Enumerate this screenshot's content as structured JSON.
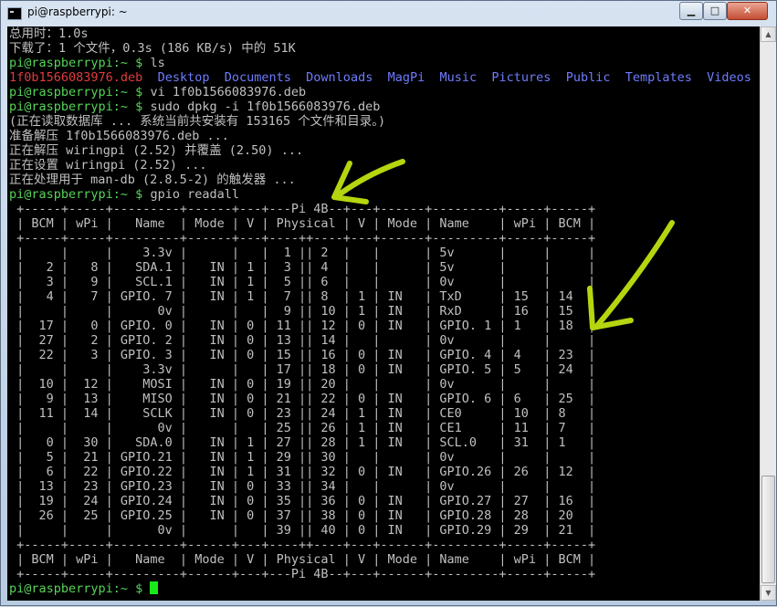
{
  "window": {
    "title": "pi@raspberrypi: ~"
  },
  "controls": {
    "minimize": "▁",
    "maximize": "□",
    "close": "✕"
  },
  "colors": {
    "prompt": "#57d457",
    "directory": "#6e7cff",
    "archive": "#e03c3c",
    "cursor": "#19e819",
    "annotation": "#b5d60f"
  },
  "icons": [
    "terminal-icon",
    "annotation-arrow-icon"
  ],
  "lines": [
    [
      {
        "t": "总用时：1.0s",
        "c": ""
      }
    ],
    [
      {
        "t": "下载了：1 个文件，0.3s (186 KB/s) 中的 51K",
        "c": ""
      }
    ],
    [
      {
        "t": "pi@raspberrypi:~ $ ",
        "c": "g"
      },
      {
        "t": "ls",
        "c": ""
      }
    ],
    [
      {
        "t": "1f0b1566083976.deb",
        "c": "r"
      },
      {
        "t": "  ",
        "c": ""
      },
      {
        "t": "Desktop",
        "c": "b"
      },
      {
        "t": "  ",
        "c": ""
      },
      {
        "t": "Documents",
        "c": "b"
      },
      {
        "t": "  ",
        "c": ""
      },
      {
        "t": "Downloads",
        "c": "b"
      },
      {
        "t": "  ",
        "c": ""
      },
      {
        "t": "MagPi",
        "c": "b"
      },
      {
        "t": "  ",
        "c": ""
      },
      {
        "t": "Music",
        "c": "b"
      },
      {
        "t": "  ",
        "c": ""
      },
      {
        "t": "Pictures",
        "c": "b"
      },
      {
        "t": "  ",
        "c": ""
      },
      {
        "t": "Public",
        "c": "b"
      },
      {
        "t": "  ",
        "c": ""
      },
      {
        "t": "Templates",
        "c": "b"
      },
      {
        "t": "  ",
        "c": ""
      },
      {
        "t": "Videos",
        "c": "b"
      }
    ],
    [
      {
        "t": "pi@raspberrypi:~ $ ",
        "c": "g"
      },
      {
        "t": "vi 1f0b1566083976.deb",
        "c": ""
      }
    ],
    [
      {
        "t": "pi@raspberrypi:~ $ ",
        "c": "g"
      },
      {
        "t": "sudo dpkg -i 1f0b1566083976.deb",
        "c": ""
      }
    ],
    [
      {
        "t": "(正在读取数据库 ... 系统当前共安装有 153165 个文件和目录。)",
        "c": ""
      }
    ],
    [
      {
        "t": "准备解压 1f0b1566083976.deb ...",
        "c": ""
      }
    ],
    [
      {
        "t": "正在解压 wiringpi (2.52) 并覆盖 (2.50) ...",
        "c": ""
      }
    ],
    [
      {
        "t": "正在设置 wiringpi (2.52) ...",
        "c": ""
      }
    ],
    [
      {
        "t": "正在处理用于 man-db (2.8.5-2) 的触发器 ...",
        "c": ""
      }
    ],
    [
      {
        "t": "pi@raspberrypi:~ $ ",
        "c": "g"
      },
      {
        "t": "gpio readall",
        "c": ""
      }
    ],
    [
      {
        "t": " +-----+-----+---------+------+---+---Pi 4B--+---+------+---------+-----+-----+",
        "c": ""
      }
    ],
    [
      {
        "t": " | BCM | wPi |   Name  | Mode | V | Physical | V | Mode | Name    | wPi | BCM |",
        "c": ""
      }
    ],
    [
      {
        "t": " +-----+-----+---------+------+---+----++----+---+------+---------+-----+-----+",
        "c": ""
      }
    ],
    [
      {
        "t": " |     |     |    3.3v |      |   |  1 || 2  |   |      | 5v      |     |     |",
        "c": ""
      }
    ],
    [
      {
        "t": " |   2 |   8 |   SDA.1 |   IN | 1 |  3 || 4  |   |      | 5v      |     |     |",
        "c": ""
      }
    ],
    [
      {
        "t": " |   3 |   9 |   SCL.1 |   IN | 1 |  5 || 6  |   |      | 0v      |     |     |",
        "c": ""
      }
    ],
    [
      {
        "t": " |   4 |   7 | GPIO. 7 |   IN | 1 |  7 || 8  | 1 | IN   | TxD     | 15  | 14  |",
        "c": ""
      }
    ],
    [
      {
        "t": " |     |     |      0v |      |   |  9 || 10 | 1 | IN   | RxD     | 16  | 15  |",
        "c": ""
      }
    ],
    [
      {
        "t": " |  17 |   0 | GPIO. 0 |   IN | 0 | 11 || 12 | 0 | IN   | GPIO. 1 | 1   | 18  |",
        "c": ""
      }
    ],
    [
      {
        "t": " |  27 |   2 | GPIO. 2 |   IN | 0 | 13 || 14 |   |      | 0v      |     |     |",
        "c": ""
      }
    ],
    [
      {
        "t": " |  22 |   3 | GPIO. 3 |   IN | 0 | 15 || 16 | 0 | IN   | GPIO. 4 | 4   | 23  |",
        "c": ""
      }
    ],
    [
      {
        "t": " |     |     |    3.3v |      |   | 17 || 18 | 0 | IN   | GPIO. 5 | 5   | 24  |",
        "c": ""
      }
    ],
    [
      {
        "t": " |  10 |  12 |    MOSI |   IN | 0 | 19 || 20 |   |      | 0v      |     |     |",
        "c": ""
      }
    ],
    [
      {
        "t": " |   9 |  13 |    MISO |   IN | 0 | 21 || 22 | 0 | IN   | GPIO. 6 | 6   | 25  |",
        "c": ""
      }
    ],
    [
      {
        "t": " |  11 |  14 |    SCLK |   IN | 0 | 23 || 24 | 1 | IN   | CE0     | 10  | 8   |",
        "c": ""
      }
    ],
    [
      {
        "t": " |     |     |      0v |      |   | 25 || 26 | 1 | IN   | CE1     | 11  | 7   |",
        "c": ""
      }
    ],
    [
      {
        "t": " |   0 |  30 |   SDA.0 |   IN | 1 | 27 || 28 | 1 | IN   | SCL.0   | 31  | 1   |",
        "c": ""
      }
    ],
    [
      {
        "t": " |   5 |  21 | GPIO.21 |   IN | 1 | 29 || 30 |   |      | 0v      |     |     |",
        "c": ""
      }
    ],
    [
      {
        "t": " |   6 |  22 | GPIO.22 |   IN | 1 | 31 || 32 | 0 | IN   | GPIO.26 | 26  | 12  |",
        "c": ""
      }
    ],
    [
      {
        "t": " |  13 |  23 | GPIO.23 |   IN | 0 | 33 || 34 |   |      | 0v      |     |     |",
        "c": ""
      }
    ],
    [
      {
        "t": " |  19 |  24 | GPIO.24 |   IN | 0 | 35 || 36 | 0 | IN   | GPIO.27 | 27  | 16  |",
        "c": ""
      }
    ],
    [
      {
        "t": " |  26 |  25 | GPIO.25 |   IN | 0 | 37 || 38 | 0 | IN   | GPIO.28 | 28  | 20  |",
        "c": ""
      }
    ],
    [
      {
        "t": " |     |     |      0v |      |   | 39 || 40 | 0 | IN   | GPIO.29 | 29  | 21  |",
        "c": ""
      }
    ],
    [
      {
        "t": " +-----+-----+---------+------+---+----++----+---+------+---------+-----+-----+",
        "c": ""
      }
    ],
    [
      {
        "t": " | BCM | wPi |   Name  | Mode | V | Physical | V | Mode | Name    | wPi | BCM |",
        "c": ""
      }
    ],
    [
      {
        "t": " +-----+-----+---------+------+---+---Pi 4B--+---+------+---------+-----+-----+",
        "c": ""
      }
    ],
    [
      {
        "t": "pi@raspberrypi:~ $ ",
        "c": "g"
      },
      {
        "t": "",
        "c": "cursor"
      }
    ]
  ]
}
